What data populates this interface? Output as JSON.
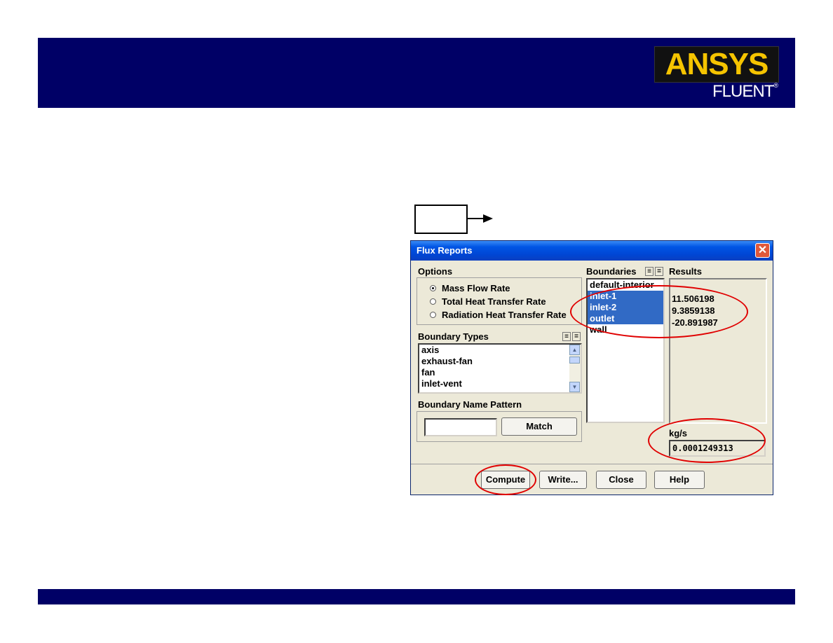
{
  "logo": {
    "brand": "ANSYS",
    "product": "FLUENT",
    "reg": "®"
  },
  "dialog": {
    "title": "Flux Reports",
    "options": {
      "label": "Options",
      "items": [
        {
          "label": "Mass Flow Rate",
          "selected": true
        },
        {
          "label": "Total Heat Transfer Rate",
          "selected": false
        },
        {
          "label": "Radiation Heat Transfer Rate",
          "selected": false
        }
      ]
    },
    "boundary_types": {
      "label": "Boundary Types",
      "items": [
        "axis",
        "exhaust-fan",
        "fan",
        "inlet-vent"
      ]
    },
    "name_pattern": {
      "label": "Boundary Name Pattern",
      "value": "",
      "match_label": "Match"
    },
    "boundaries": {
      "label": "Boundaries",
      "items": [
        {
          "label": "default-interior",
          "selected": false
        },
        {
          "label": "inlet-1",
          "selected": true
        },
        {
          "label": "inlet-2",
          "selected": true
        },
        {
          "label": "outlet",
          "selected": true
        },
        {
          "label": "wall",
          "selected": false
        }
      ]
    },
    "results": {
      "label": "Results",
      "values": [
        "11.506198",
        "9.3859138",
        "-20.891987"
      ],
      "unit": "kg/s",
      "net": "0.0001249313"
    },
    "buttons": {
      "compute": "Compute",
      "write": "Write...",
      "close": "Close",
      "help": "Help"
    }
  },
  "colors": {
    "banner": "#000066",
    "highlight": "#316ac5",
    "annotation": "#e00000",
    "logo_gold": "#f5c400"
  }
}
